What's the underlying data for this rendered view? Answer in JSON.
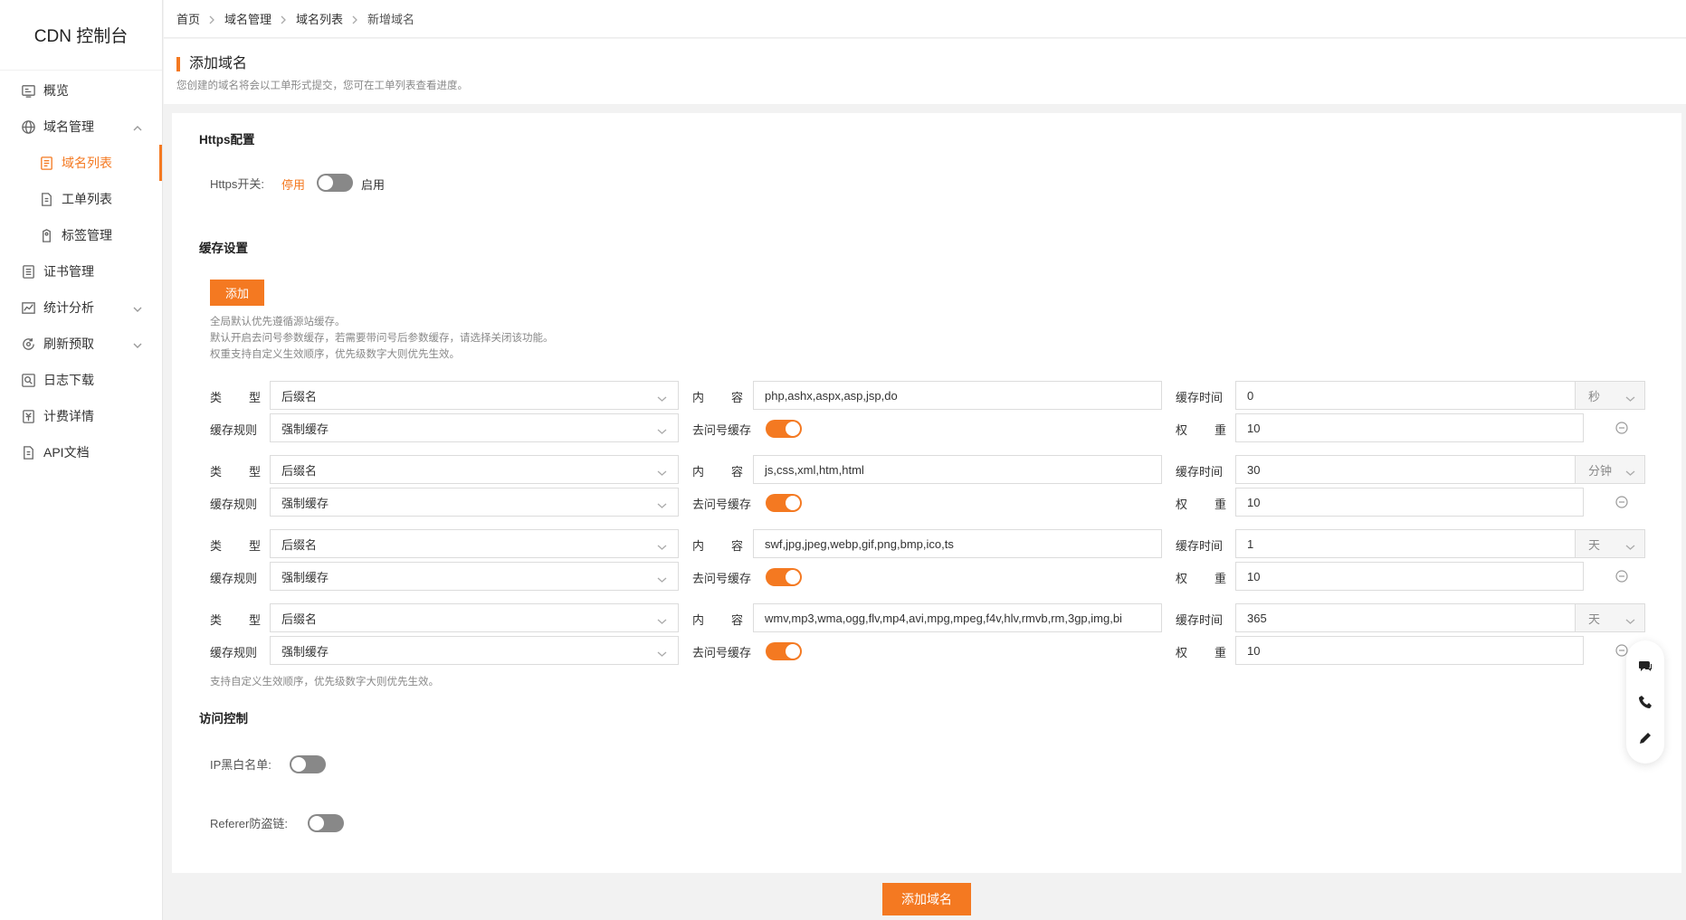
{
  "app": {
    "title": "CDN 控制台"
  },
  "sidebar": {
    "items": [
      {
        "label": "概览",
        "icon": "overview-icon"
      },
      {
        "label": "域名管理",
        "icon": "globe-icon",
        "expanded": true
      },
      {
        "label": "域名列表",
        "icon": "domain-list-icon",
        "active": true
      },
      {
        "label": "工单列表",
        "icon": "ticket-icon"
      },
      {
        "label": "标签管理",
        "icon": "tag-icon"
      },
      {
        "label": "证书管理",
        "icon": "certificate-icon"
      },
      {
        "label": "统计分析",
        "icon": "chart-icon"
      },
      {
        "label": "刷新预取",
        "icon": "refresh-icon"
      },
      {
        "label": "日志下载",
        "icon": "log-icon"
      },
      {
        "label": "计费详情",
        "icon": "billing-icon"
      },
      {
        "label": "API文档",
        "icon": "doc-icon"
      }
    ]
  },
  "breadcrumb": [
    "首页",
    "域名管理",
    "域名列表",
    "新增域名"
  ],
  "page": {
    "title": "添加域名",
    "description": "您创建的域名将会以工单形式提交，您可在工单列表查看进度。"
  },
  "https": {
    "section_title": "Https配置",
    "switch_label": "Https开关:",
    "off_text": "停用",
    "on_text": "启用",
    "enabled": false
  },
  "cache": {
    "section_title": "缓存设置",
    "add_button": "添加",
    "notes": [
      "全局默认优先遵循源站缓存。",
      "默认开启去问号参数缓存，若需要带问号后参数缓存，请选择关闭该功能。",
      "权重支持自定义生效顺序，优先级数字大则优先生效。"
    ],
    "labels": {
      "type_a": "类",
      "type_b": "型",
      "content_a": "内",
      "content_b": "容",
      "cache_time": "缓存时间",
      "cache_rule": "缓存规则",
      "strip_query": "去问号缓存",
      "weight_a": "权",
      "weight_b": "重"
    },
    "rules": [
      {
        "type": "后缀名",
        "content": "php,ashx,aspx,asp,jsp,do",
        "time": "0",
        "unit": "秒",
        "rule": "强制缓存",
        "strip_query": true,
        "weight": "10"
      },
      {
        "type": "后缀名",
        "content": "js,css,xml,htm,html",
        "time": "30",
        "unit": "分钟",
        "rule": "强制缓存",
        "strip_query": true,
        "weight": "10"
      },
      {
        "type": "后缀名",
        "content": "swf,jpg,jpeg,webp,gif,png,bmp,ico,ts",
        "time": "1",
        "unit": "天",
        "rule": "强制缓存",
        "strip_query": true,
        "weight": "10"
      },
      {
        "type": "后缀名",
        "content": "wmv,mp3,wma,ogg,flv,mp4,avi,mpg,mpeg,f4v,hlv,rmvb,rm,3gp,img,bi",
        "time": "365",
        "unit": "天",
        "rule": "强制缓存",
        "strip_query": true,
        "weight": "10"
      }
    ],
    "footnote": "支持自定义生效顺序，优先级数字大则优先生效。"
  },
  "access": {
    "section_title": "访问控制",
    "ip_label": "IP黑白名单:",
    "ip_enabled": false,
    "referer_label": "Referer防盗链:",
    "referer_enabled": false
  },
  "submit": {
    "label": "添加域名"
  },
  "float_tools": [
    "chat-icon",
    "phone-icon",
    "edit-icon"
  ],
  "colors": {
    "accent": "#f47921"
  }
}
